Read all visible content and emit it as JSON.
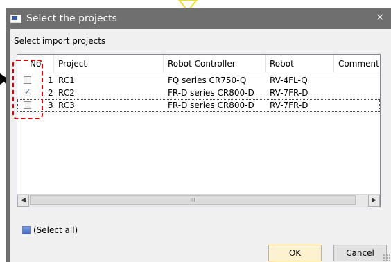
{
  "window": {
    "title": "Select the projects",
    "close_glyph": "×"
  },
  "section_label": "Select import projects",
  "grid": {
    "columns": [
      "No.",
      "Project",
      "Robot Controller",
      "Robot",
      "Comment"
    ],
    "rows": [
      {
        "no": "1",
        "checked": false,
        "project": "RC1",
        "controller": "FQ series CR750-Q",
        "robot": "RV-4FL-Q",
        "comment": ""
      },
      {
        "no": "2",
        "checked": true,
        "project": "RC2",
        "controller": "FR-D series CR800-D",
        "robot": "RV-7FR-D",
        "comment": ""
      },
      {
        "no": "3",
        "checked": false,
        "project": "RC3",
        "controller": "FR-D series CR800-D",
        "robot": "RV-7FR-D",
        "comment": ""
      }
    ],
    "scroll_thumb_glyph": "III",
    "scroll_left_glyph": "◀",
    "scroll_right_glyph": "▶"
  },
  "select_all_label": "(Select all)",
  "buttons": {
    "ok": "OK",
    "cancel": "Cancel"
  },
  "icons": {
    "title_icon": "window-app-icon",
    "close": "close-icon",
    "annotation_pointer": "yellow-triangle-pointer",
    "annotation_arrow": "black-arrow-icon"
  },
  "colors": {
    "title_bar": "#6f6f6f",
    "highlight_dash": "#e00000",
    "ok_border": "#e3b43a"
  }
}
